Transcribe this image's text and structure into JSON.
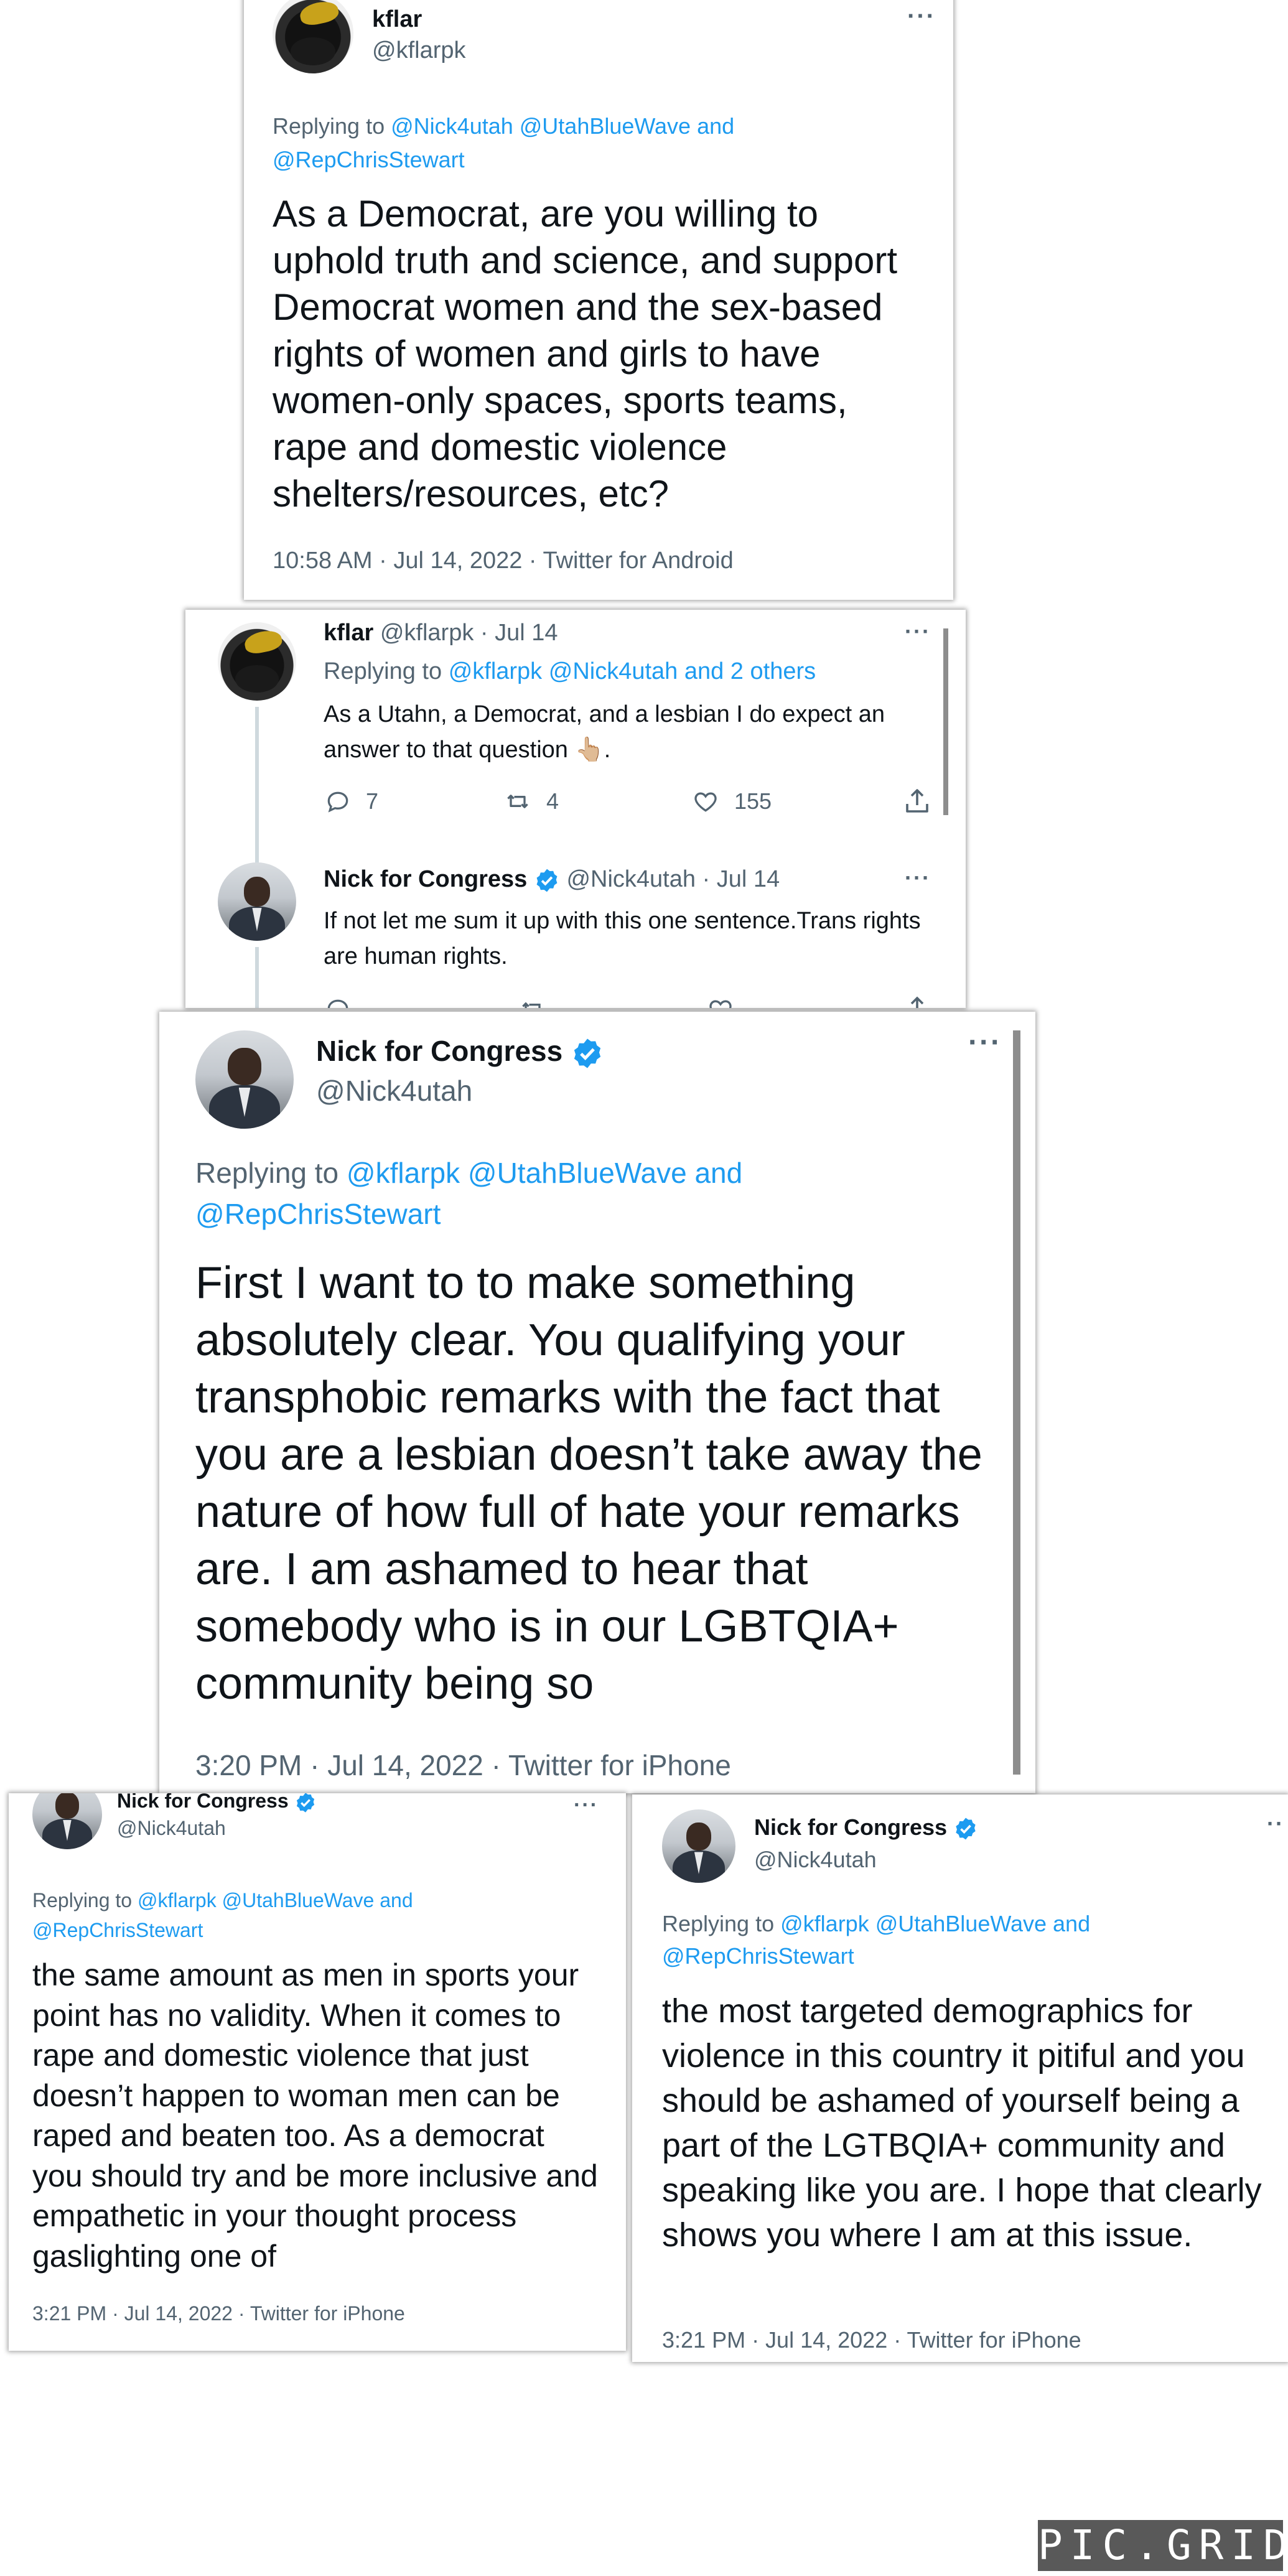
{
  "tweet1": {
    "name": "kflar",
    "handle": "@kflarpk",
    "reply_prefix": "Replying to",
    "reply_mentions_line1": "@Nick4utah @UtahBlueWave and",
    "reply_mentions_line2": "@RepChrisStewart",
    "body": "As a Democrat, are you willing to uphold truth and science, and support Democrat women and the sex-based rights of women and girls to have women-only spaces, sports teams, rape and domestic violence shelters/resources, etc?",
    "meta": "10:58 AM · Jul 14, 2022 · Twitter for Android",
    "more": "···"
  },
  "thread": {
    "tweet_a": {
      "name": "kflar",
      "handle_date": "@kflarpk · Jul 14",
      "reply_prefix": "Replying to",
      "reply_mentions": "@kflarpk @Nick4utah and 2 others",
      "body": "As a Utahn, a Democrat, and a lesbian I do expect an answer to that question 👆🏼.",
      "replies": "7",
      "retweets": "4",
      "likes": "155",
      "more": "···"
    },
    "tweet_b": {
      "name": "Nick for Congress",
      "handle_date": "@Nick4utah · Jul 14",
      "body": "If not let me sum it up with this one sentence.Trans rights are human rights.",
      "more": "···"
    }
  },
  "tweet3": {
    "name": "Nick for Congress",
    "handle": "@Nick4utah",
    "reply_prefix": "Replying to",
    "reply_mentions_line1": "@kflarpk @UtahBlueWave and",
    "reply_mentions_line2": "@RepChrisStewart",
    "body": "First I want to to make something absolutely clear. You qualifying your transphobic remarks with the fact that you are a lesbian doesn’t take away the nature of  how full of hate your remarks are. I am ashamed to hear that somebody who is in our LGBTQIA+ community being so",
    "meta": "3:20 PM · Jul 14, 2022 · Twitter for iPhone",
    "more": "···"
  },
  "tweet4": {
    "name": "Nick for Congress",
    "handle": "@Nick4utah",
    "reply_prefix": "Replying to",
    "reply_mentions_line1": "@kflarpk @UtahBlueWave and",
    "reply_mentions_line2": "@RepChrisStewart",
    "body": "the same amount as men in sports your point has no validity. When it comes to rape and domestic violence that just doesn’t happen to woman men can be raped and beaten too. As a democrat you should try and be more inclusive and empathetic in your thought process gaslighting one of",
    "meta": "3:21 PM · Jul 14, 2022 · Twitter for iPhone",
    "more": "···"
  },
  "tweet5": {
    "name": "Nick for Congress",
    "handle": "@Nick4utah",
    "reply_prefix": "Replying to",
    "reply_mentions_line1": "@kflarpk @UtahBlueWave and",
    "reply_mentions_line2": "@RepChrisStewart",
    "body": "the most targeted demographics for violence in this country it pitiful and you should be ashamed of yourself being a part of the LGTBQIA+ community and speaking like you are. I hope that clearly shows you where I am at this issue.",
    "meta": "3:21 PM · Jul 14, 2022 · Twitter for iPhone",
    "more": "··"
  },
  "watermark": "PIC.GRID",
  "colors": {
    "link": "#1d9bf0",
    "secondary_text": "#536471",
    "verified": "#1d9bf0",
    "watermark_bg": "#595959"
  },
  "icons": [
    "reply-icon",
    "retweet-icon",
    "like-icon",
    "share-icon",
    "verified-badge-icon",
    "more-options-icon"
  ]
}
